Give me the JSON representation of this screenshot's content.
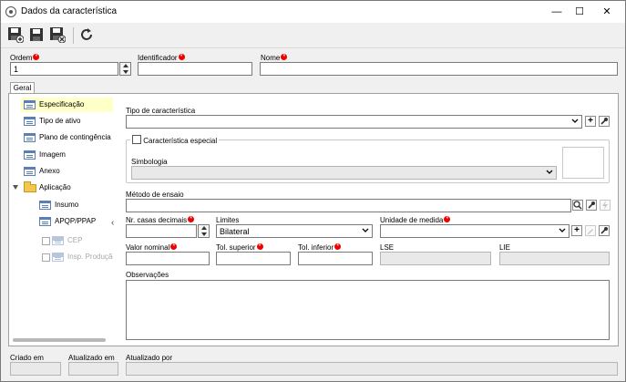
{
  "window": {
    "title": "Dados da característica"
  },
  "titlebar": {
    "minimize": "—",
    "maximize": "☐",
    "close": "✕"
  },
  "toolbar": {
    "icons": [
      "save-new-icon",
      "save-icon",
      "save-close-icon",
      "refresh-icon"
    ]
  },
  "header": {
    "ordem_label": "Ordem",
    "ordem_value": "1",
    "identificador_label": "Identificador",
    "identificador_value": "",
    "nome_label": "Nome",
    "nome_value": ""
  },
  "tabs": [
    {
      "label": "Geral"
    }
  ],
  "tree": {
    "items": [
      {
        "label": "Especificação"
      },
      {
        "label": "Tipo de ativo"
      },
      {
        "label": "Plano de contingência"
      },
      {
        "label": "Imagem"
      },
      {
        "label": "Anexo"
      },
      {
        "label": "Aplicação"
      },
      {
        "label": "Insumo"
      },
      {
        "label": "APQP/PPAP"
      },
      {
        "label": "CEP"
      },
      {
        "label": "Insp. Produção"
      }
    ],
    "collapse_glyph": "‹"
  },
  "form": {
    "tipo_label": "Tipo de característica",
    "tipo_value": "",
    "especial_label": "Característica especial",
    "simbologia_label": "Simbologia",
    "simbologia_value": "",
    "metodo_label": "Método de ensaio",
    "metodo_value": "",
    "casas_label": "Nr. casas decimais",
    "casas_value": "",
    "limites_label": "Limites",
    "limites_value": "Bilateral",
    "unidade_label": "Unidade de medida",
    "unidade_value": "",
    "nominal_label": "Valor nominal",
    "nominal_value": "",
    "tol_sup_label": "Tol. superior",
    "tol_sup_value": "",
    "tol_inf_label": "Tol. inferior",
    "tol_inf_value": "",
    "lse_label": "LSE",
    "lse_value": "",
    "lie_label": "LIE",
    "lie_value": "",
    "obs_label": "Observações",
    "obs_value": ""
  },
  "footer": {
    "criado_label": "Criado em",
    "criado_value": "",
    "atualizado_em_label": "Atualizado em",
    "atualizado_em_value": "",
    "atualizado_por_label": "Atualizado por",
    "atualizado_por_value": ""
  },
  "glyphs": {
    "plus": "+",
    "required": "*"
  }
}
